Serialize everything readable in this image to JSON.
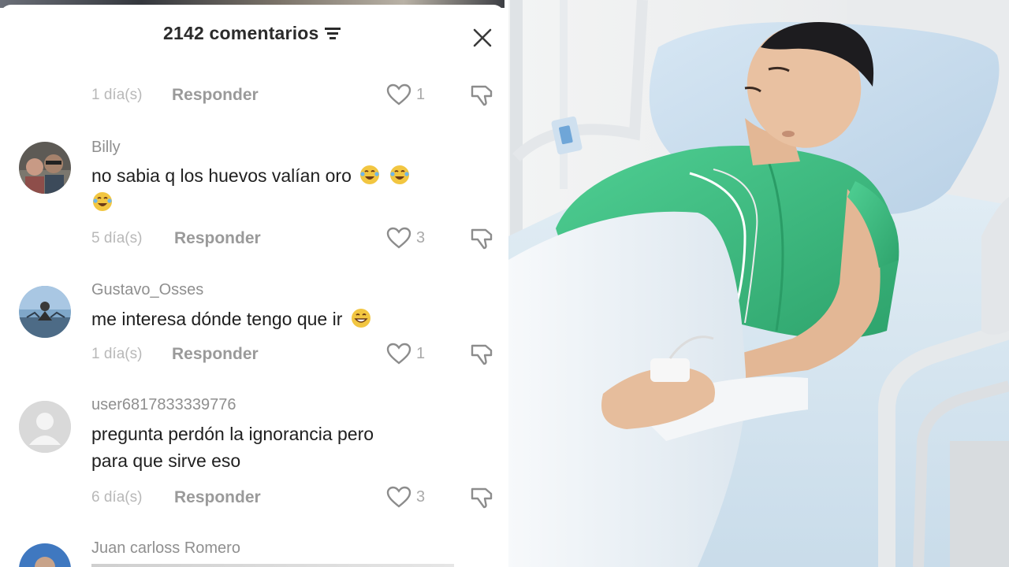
{
  "header": {
    "comment_count": "2142 comentarios"
  },
  "top_partial": {
    "age": "1 día(s)",
    "reply_label": "Responder",
    "likes": "1"
  },
  "comments": [
    {
      "username": "Billy",
      "text_line1": "no sabia q los huevos valían oro",
      "age": "5 día(s)",
      "reply_label": "Responder",
      "likes": "3",
      "emoji": "laughing-tears-emoji"
    },
    {
      "username": "Gustavo_Osses",
      "text_line1": "me interesa dónde tengo que ir",
      "age": "1 día(s)",
      "reply_label": "Responder",
      "likes": "1",
      "emoji": "grinning-emoji"
    },
    {
      "username": "user6817833339776",
      "text_line1": "pregunta perdón la ignorancia pero",
      "text_line2": "para que sirve eso",
      "age": "6 día(s)",
      "reply_label": "Responder",
      "likes": "3"
    },
    {
      "username": "Juan carloss Romero"
    }
  ],
  "photo": {
    "subject": "man-in-hospital-bed",
    "gown_color": "#3fbf83",
    "sheet_color": "#d9e9f2"
  },
  "colors": {
    "text_primary": "#1f1f1f",
    "text_secondary": "#8f8f8f",
    "icon_gray": "#8c8c8c"
  }
}
